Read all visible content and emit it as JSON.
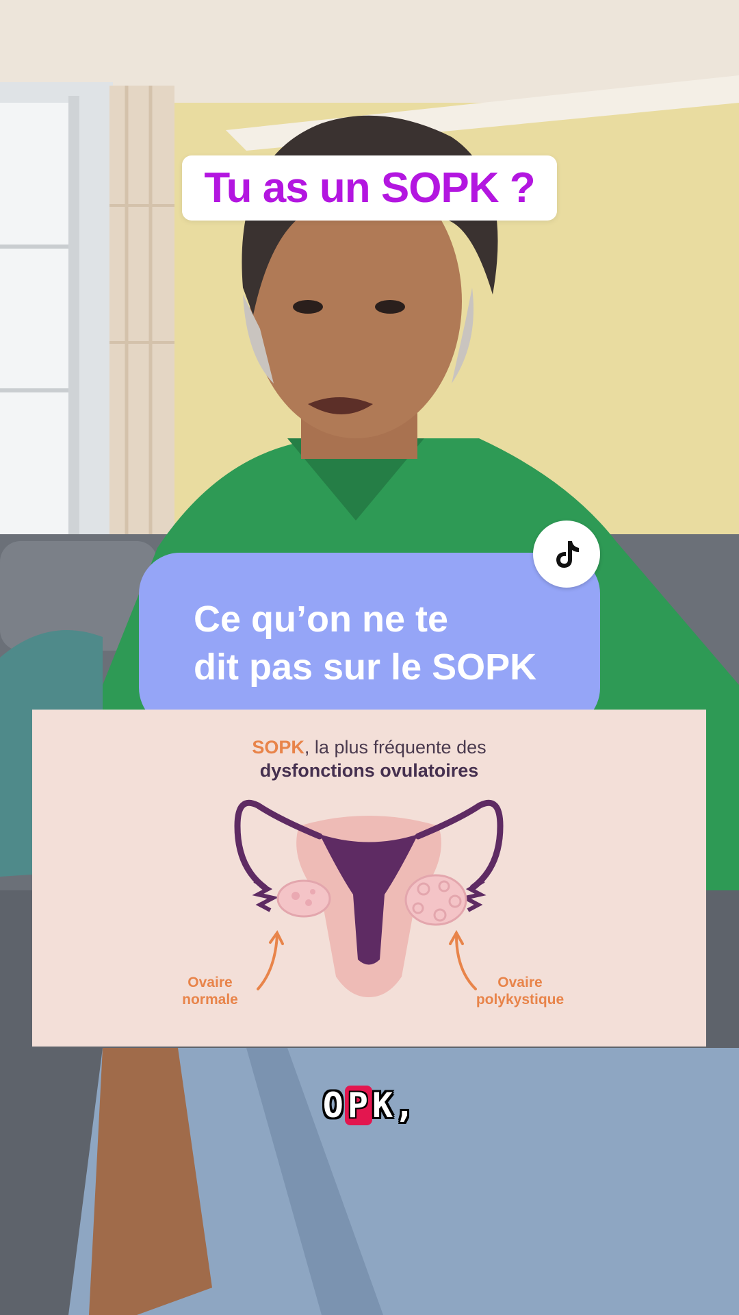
{
  "video": {
    "title_overlay": "Tu as un SOPK ?",
    "promo_card": {
      "text": "Ce qu’on ne te\ndit pas sur le SOPK",
      "badge_icon": "tiktok-icon"
    },
    "diagram_panel": {
      "heading_accent": "SOPK",
      "heading_rest": ", la plus fréquente des",
      "heading_line2": "dysfonctions ovulatoires",
      "label_left": "Ovaire\nnormale",
      "label_right": "Ovaire\npolykystique"
    },
    "caption": {
      "before": "O",
      "highlight": "P",
      "after": "K,"
    }
  },
  "colors": {
    "title_text": "#b316e0",
    "promo_bg": "#95a5f7",
    "panel_bg": "#f3dfd8",
    "diagram_accent": "#e8844a",
    "caption_highlight": "#e3164f"
  }
}
